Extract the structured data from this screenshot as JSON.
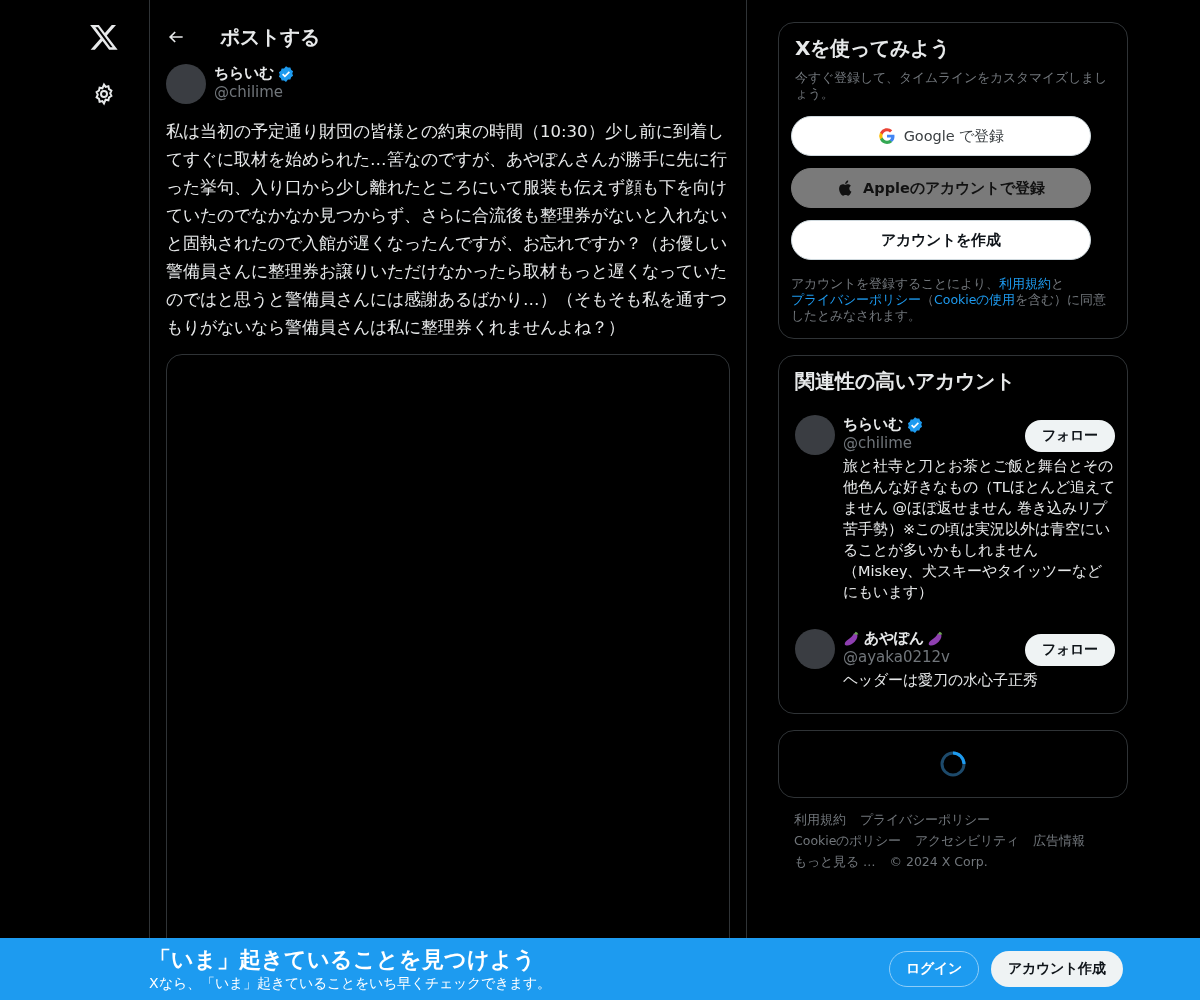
{
  "header": {
    "title": "ポストする"
  },
  "post": {
    "author": {
      "name": "ちらいむ",
      "handle": "@chilime",
      "verified": true
    },
    "text": "私は当初の予定通り財団の皆様との約束の時間（10:30）少し前に到着してすぐに取材を始められた…筈なのですが、あやぽんさんが勝手に先に行った挙句、入り口から少し離れたところにいて服装も伝えず顔も下を向けていたのでなかなか見つからず、さらに合流後も整理券がないと入れないと固執されたので入館が遅くなったんですが、お忘れですか？（お優しい警備員さんに整理券お譲りいただけなかったら取材もっと遅くなっていたのではと思うと警備員さんには感謝あるばかり…）（そもそも私を通すつもりがないなら警備員さんは私に整理券くれませんよね？）"
  },
  "signup": {
    "title": "Xを使ってみよう",
    "subtitle": "今すぐ登録して、タイムラインをカスタマイズしましょう。",
    "buttons": [
      {
        "kind": "google",
        "label": "Google で登録"
      },
      {
        "kind": "apple",
        "label": "Appleのアカウントで登録"
      },
      {
        "kind": "create",
        "label": "アカウントを作成"
      }
    ],
    "legal": [
      {
        "text": "アカウントを登録することにより、",
        "link": false
      },
      {
        "text": "利用規約",
        "link": true
      },
      {
        "text": "と",
        "link": false
      },
      {
        "text": "プライバシーポリシー",
        "link": true
      },
      {
        "text": "（",
        "link": false
      },
      {
        "text": "Cookieの使用",
        "link": true
      },
      {
        "text": "を含む）に同意したとみなされます。",
        "link": false
      }
    ]
  },
  "related": {
    "title": "関連性の高いアカウント",
    "accounts": [
      {
        "name": "ちらいむ",
        "eggplant": false,
        "handle": "@chilime",
        "verified": true,
        "follow": "フォロー",
        "bio": "旅と社寺と刀とお茶とご飯と舞台とその他色んな好きなもの（TLほとんど追えてません @ほぼ返せません 巻き込みリプ苦手勢）※この頃は実況以外は青空にいることが多いかもしれません（Miskey、犬スキーやタイッツーなどにもいます）"
      },
      {
        "name": "あやぽん",
        "eggplant": true,
        "handle": "@ayaka0212v",
        "verified": false,
        "follow": "フォロー",
        "bio": "ヘッダーは愛刀の水心子正秀"
      }
    ]
  },
  "footer": [
    [
      "利用規約",
      "プライバシーポリシー"
    ],
    [
      "Cookieのポリシー",
      "アクセシビリティ",
      "広告情報"
    ],
    [
      "もっと見る …",
      "© 2024 X Corp."
    ]
  ],
  "banner": {
    "title": "「いま」起きていることを見つけよう",
    "subtitle": "Xなら、「いま」起きていることをいち早くチェックできます。",
    "login": "ログイン",
    "signup": "アカウント作成"
  }
}
